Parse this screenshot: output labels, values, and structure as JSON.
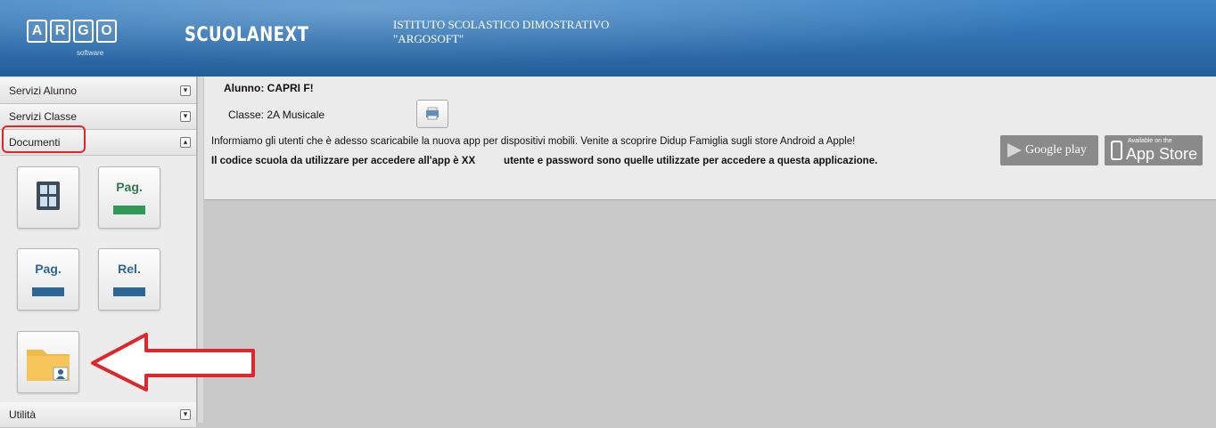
{
  "header": {
    "logo_letters": [
      "A",
      "R",
      "G",
      "O"
    ],
    "logo_sub": "software",
    "brand": "SCUOLANEXT",
    "school_line1": "ISTITUTO SCOLASTICO DIMOSTRATIVO",
    "school_line2": "\"ARGOSOFT\""
  },
  "sidebar": {
    "sections": [
      {
        "label": "Servizi Alunno",
        "toggle": "▾"
      },
      {
        "label": "Servizi Classe",
        "toggle": "▾"
      },
      {
        "label": "Documenti",
        "toggle": "▴"
      },
      {
        "label": "Utilità",
        "toggle": "▾"
      }
    ],
    "tiles": [
      {
        "icon": "grid-document-icon"
      },
      {
        "text": "Pag.",
        "bar_color": "#2f9a55"
      },
      {
        "text": "Pag.",
        "bar_color": "#2d6798"
      },
      {
        "text": "Rel.",
        "bar_color": "#2d6798"
      },
      {
        "icon": "folder-user-icon"
      }
    ]
  },
  "main": {
    "student_label": "Alunno: CAPRI F!",
    "class_label": "Classe: 2A Musicale",
    "info_line1": "Informiamo gli utenti che è adesso scaricabile la nuova app per dispositivi mobili. Venite a scoprire Didup Famiglia sugli store Android a Apple!",
    "info_line2": "Il codice scuola da utilizzare per accedere all'app è XX          utente e password sono quelle utilizzate per accedere a questa applicazione.",
    "google_play": "Google play",
    "app_store_small": "Available on the",
    "app_store": "App Store"
  },
  "colors": {
    "header": "#2e6fae",
    "highlight_red": "#e0262b"
  }
}
